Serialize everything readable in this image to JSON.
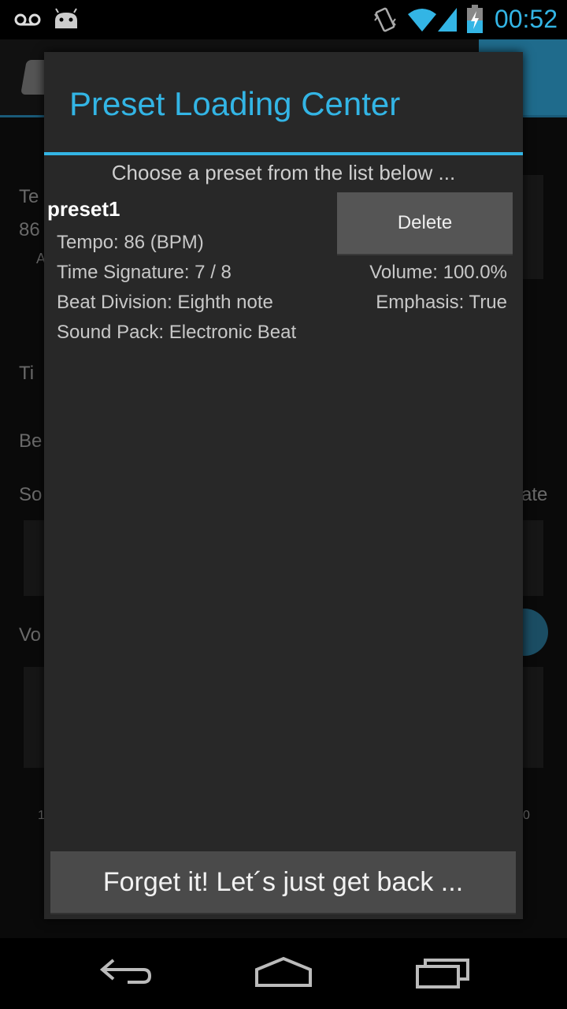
{
  "status_bar": {
    "clock": "00:52",
    "icons": [
      "voicemail-icon",
      "android-icon",
      "vibrate-icon",
      "wifi-icon",
      "signal-icon",
      "battery-charging-icon"
    ]
  },
  "background": {
    "labels": [
      "Te",
      "86",
      "A",
      "Ti",
      "Be",
      "So",
      "ate",
      "Vo",
      "1",
      "0"
    ]
  },
  "dialog": {
    "title": "Preset Loading Center",
    "subtitle": "Choose a preset from the list below ...",
    "preset": {
      "name": "preset1",
      "tempo": "Tempo: 86 (BPM)",
      "time_signature": "Time Signature: 7 / 8",
      "beat_division": "Beat Division: Eighth note",
      "sound_pack": "Sound Pack: Electronic Beat",
      "volume": "Volume: 100.0%",
      "emphasis": "Emphasis: True",
      "delete_label": "Delete"
    },
    "back_button": "Forget it! Let´s just get back ..."
  },
  "nav_bar": {
    "icons": [
      "back-icon",
      "home-icon",
      "recent-apps-icon"
    ]
  },
  "colors": {
    "accent": "#33b5e5",
    "dialog_bg": "#282828",
    "button_bg": "#555555"
  }
}
